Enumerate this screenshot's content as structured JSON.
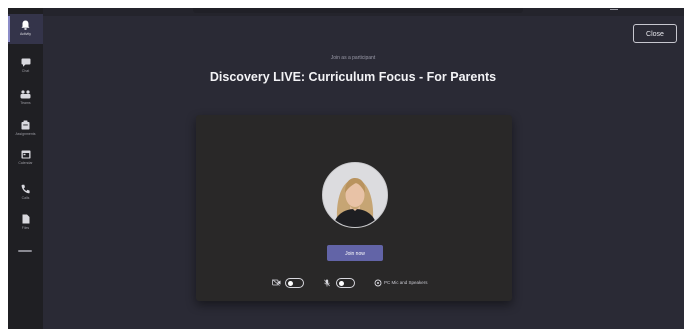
{
  "app": {
    "rail": [
      {
        "id": "activity",
        "label": "Activity",
        "icon": "bell-icon",
        "active": true
      },
      {
        "id": "chat",
        "label": "Chat",
        "icon": "chat-icon",
        "active": false
      },
      {
        "id": "teams",
        "label": "Teams",
        "icon": "teams-icon",
        "active": false
      },
      {
        "id": "assignments",
        "label": "Assignments",
        "icon": "assignments-icon",
        "active": false
      },
      {
        "id": "calendar",
        "label": "Calendar",
        "icon": "calendar-icon",
        "active": false
      },
      {
        "id": "calls",
        "label": "Calls",
        "icon": "phone-icon",
        "active": false
      },
      {
        "id": "files",
        "label": "Files",
        "icon": "file-icon",
        "active": false
      }
    ],
    "more_icon": "ellipsis-icon"
  },
  "header": {
    "close_label": "Close"
  },
  "prejoin": {
    "subtitle": "Join as a participant",
    "meeting_title": "Discovery LIVE: Curriculum Focus - For Parents",
    "join_label": "Join now",
    "camera_icon": "camera-off-icon",
    "mic_icon": "mic-off-icon",
    "settings_icon": "gear-icon",
    "audio_device_label": "PC Mic and Speakers",
    "camera_on": false,
    "mic_on": false
  },
  "colors": {
    "accent": "#6264a7",
    "background": "#2a2a35",
    "rail": "#1f1f23",
    "preview": "#292828"
  }
}
